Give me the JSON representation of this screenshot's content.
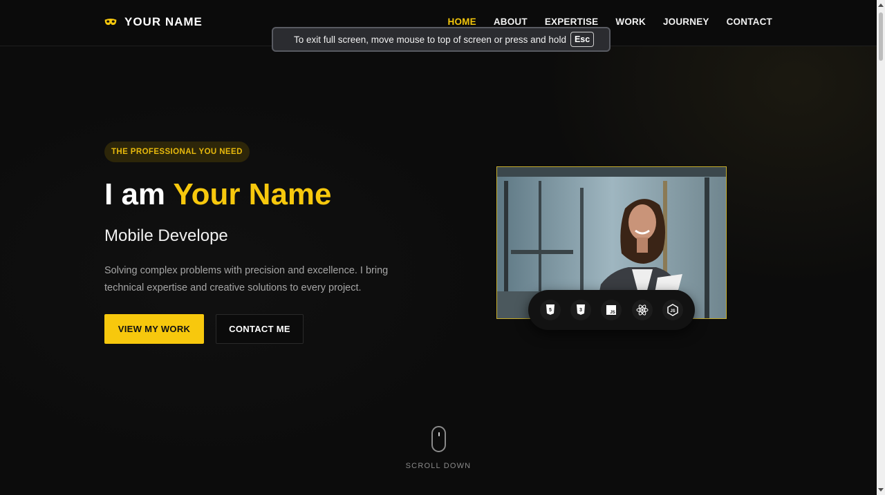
{
  "brand": {
    "name": "YOUR NAME",
    "logo_icon": "mask-icon",
    "accent": "#f7c80d"
  },
  "nav": {
    "items": [
      {
        "label": "HOME",
        "active": true
      },
      {
        "label": "ABOUT",
        "active": false
      },
      {
        "label": "EXPERTISE",
        "active": false
      },
      {
        "label": "WORK",
        "active": false
      },
      {
        "label": "JOURNEY",
        "active": false
      },
      {
        "label": "CONTACT",
        "active": false
      }
    ]
  },
  "fullscreen_notice": {
    "text": "To exit full screen, move mouse to top of screen or press and hold",
    "key": "Esc"
  },
  "hero": {
    "badge": "THE PROFESSIONAL YOU NEED",
    "title_prefix": "I am",
    "title_name": "Your Name",
    "role": "Mobile Develope",
    "description": "Solving complex problems with precision and excellence. I bring technical expertise and creative solutions to every project.",
    "primary_button": "VIEW MY WORK",
    "secondary_button": "CONTACT ME",
    "tech_icons": [
      "html5-icon",
      "css3-icon",
      "javascript-icon",
      "react-icon",
      "nodejs-icon"
    ]
  },
  "scroll": {
    "label": "SCROLL DOWN"
  }
}
